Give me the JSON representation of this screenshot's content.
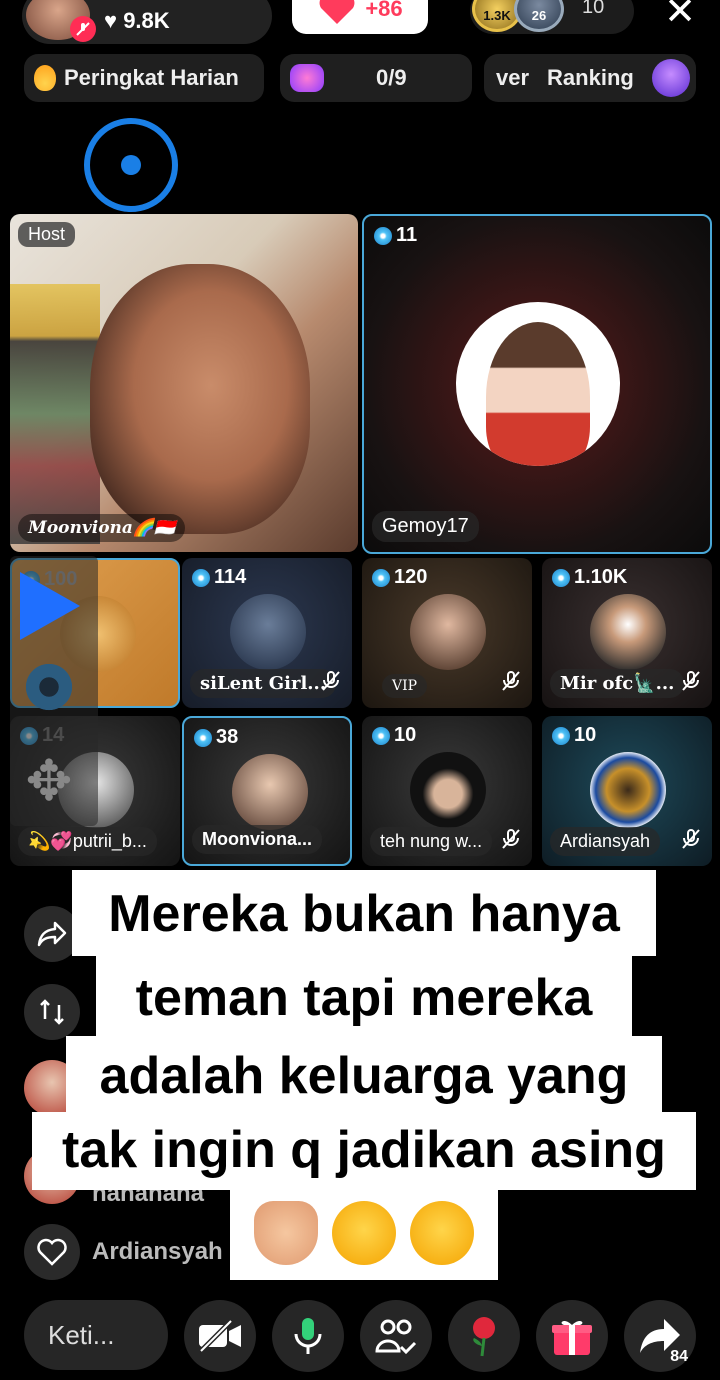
{
  "header": {
    "host_likes": "9.8K",
    "like_increment": "+86",
    "viewer_badges": [
      "1.3K",
      "26"
    ],
    "viewer_count": "10"
  },
  "chips": {
    "daily_rank": "Peringkat Harian",
    "gift_progress": "0/9",
    "ranking_prefix": "ver",
    "ranking": "Ranking"
  },
  "host_tile": {
    "tag": "Host",
    "name": "Moonviona🌈🇮🇩"
  },
  "guests": [
    {
      "level": "11",
      "name": "Gemoy17"
    },
    {
      "level": "100",
      "name": ""
    },
    {
      "level": "114",
      "name": "siLent Girl..."
    },
    {
      "level": "120",
      "name": "VIP"
    },
    {
      "level": "1.10K",
      "name": "Mir ofc🗽..."
    },
    {
      "level": "14",
      "name": "💫💞putrii_b..."
    },
    {
      "level": "38",
      "name": "Moonviona..."
    },
    {
      "level": "10",
      "name": "teh nung w..."
    },
    {
      "level": "10",
      "name": "Ardiansyah"
    }
  ],
  "comments": [
    {
      "user": "hahahaha"
    },
    {
      "user": "Ardiansyah"
    }
  ],
  "caption": {
    "line1": "Mereka bukan hanya",
    "line2": "teman tapi mereka",
    "line3": "adalah keluarga yang",
    "line4": "tak ingin q jadikan asing",
    "emojis": "🙏🏻🥰😘"
  },
  "bottom_bar": {
    "input_placeholder": "Keti...",
    "share_count": "84"
  },
  "colors": {
    "accent_blue": "#1a7fe6",
    "tile_border": "#4aa8d8",
    "like_red": "#ff3b5c"
  }
}
